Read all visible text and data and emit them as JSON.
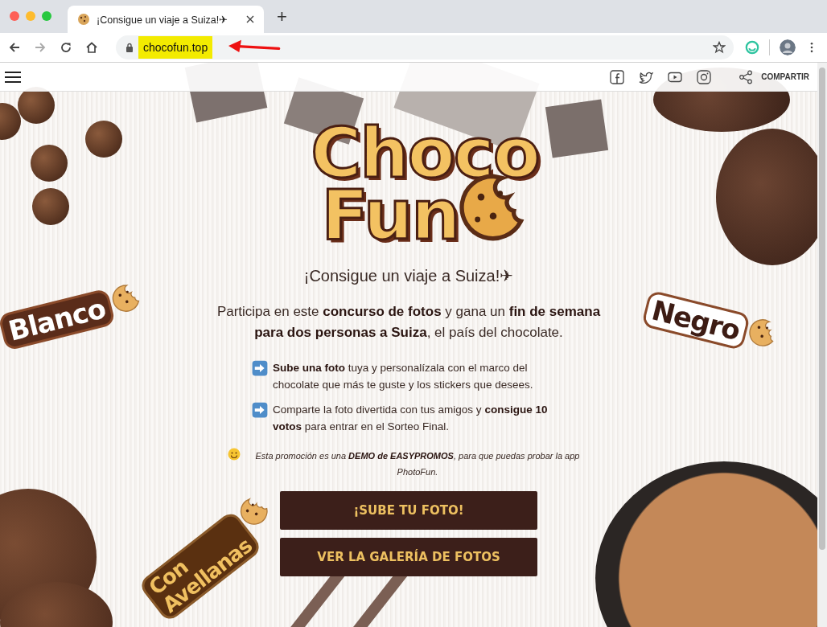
{
  "browser": {
    "tab": {
      "title": "¡Consigue un viaje a Suiza!✈",
      "selected": true
    },
    "new_tab": "+",
    "url": "chocofun.top",
    "url_highlighted": true
  },
  "site_header": {
    "share_label": "COMPARTIR"
  },
  "logo": {
    "line_1": "Choco",
    "line_2": "Fun"
  },
  "headline": "¡Consigue un viaje a Suiza!✈",
  "intro": "Participa en este **concurso de fotos** y gana un **fin de semana para dos personas a Suiza**, el país del chocolate.",
  "steps": [
    "**Sube una foto** tuya y personalízala con el marco del chocolate que más te guste y los stickers que desees.",
    "Comparte la foto divertida con tus amigos y **consigue 10 votos** para entrar en el Sorteo Final."
  ],
  "note": "Esta promoción es una **DEMO de EASYPROMOS**, para que puedas probar la app PhotoFun.",
  "buttons": [
    "¡SUBE TU FOTO!",
    "VER LA GALERÍA DE FOTOS"
  ],
  "stickers": [
    {
      "text": "Blanco",
      "kind": "white"
    },
    {
      "text": "Negro",
      "kind": "dark"
    },
    {
      "text": "Con Avellanas",
      "kind": "nut"
    }
  ]
}
